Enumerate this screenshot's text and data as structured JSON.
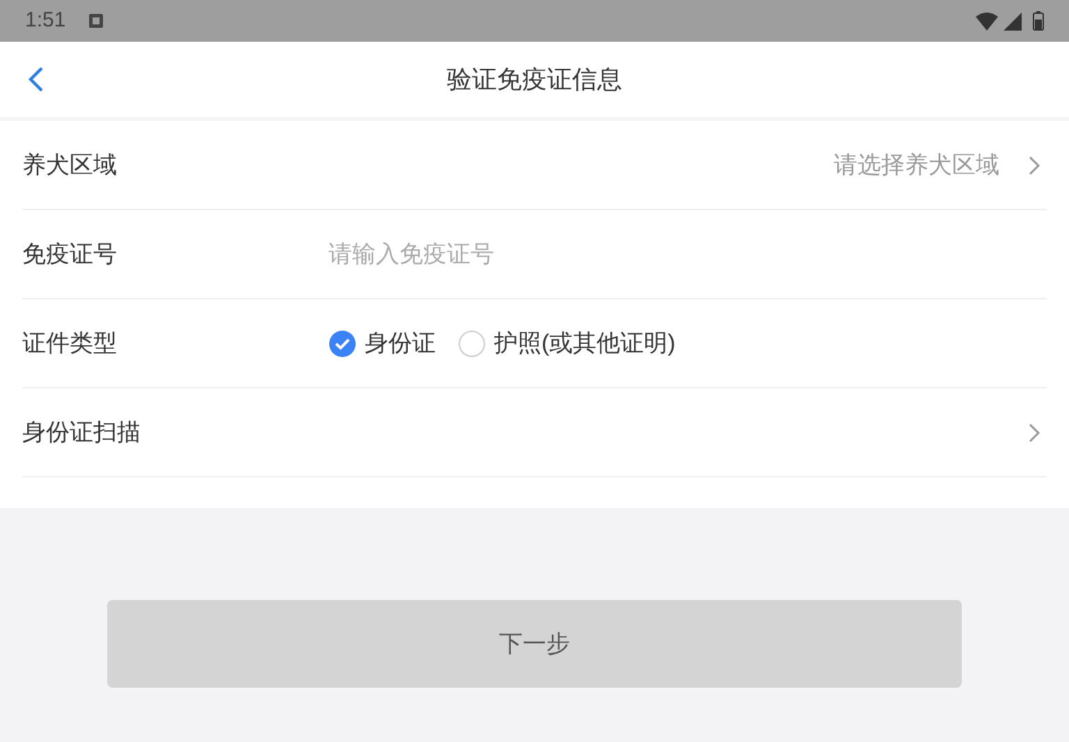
{
  "status_bar": {
    "time": "1:51"
  },
  "header": {
    "title": "验证免疫证信息"
  },
  "form_rows": [
    {
      "kind": "select",
      "label": "养犬区域",
      "placeholder": "请选择养犬区域"
    },
    {
      "kind": "input",
      "label": "免疫证号",
      "placeholder": "请输入免疫证号"
    },
    {
      "kind": "radio",
      "label": "证件类型",
      "options": [
        {
          "label": "身份证",
          "selected": true
        },
        {
          "label": "护照(或其他证明)",
          "selected": false
        }
      ]
    },
    {
      "kind": "link",
      "label": "身份证扫描"
    }
  ],
  "next_button": {
    "label": "下一步",
    "disabled": true
  }
}
